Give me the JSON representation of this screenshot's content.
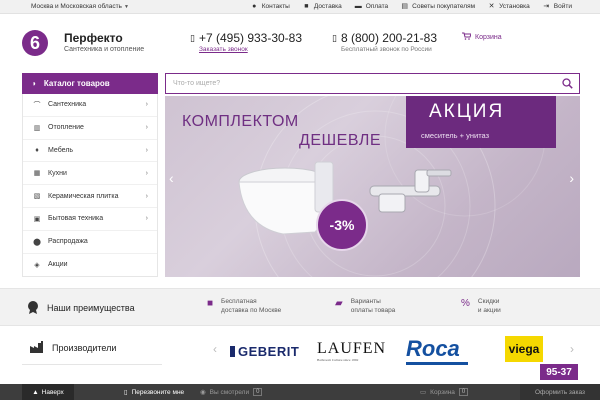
{
  "topbar": {
    "region": "Москва и Московская область",
    "links": [
      {
        "label": "Контакты",
        "icon": "location-pin-icon"
      },
      {
        "label": "Доставка",
        "icon": "truck-icon"
      },
      {
        "label": "Оплата",
        "icon": "chat-icon"
      },
      {
        "label": "Советы покупателям",
        "icon": "book-icon"
      },
      {
        "label": "Установка",
        "icon": "tools-icon"
      },
      {
        "label": "Войти",
        "icon": "login-icon"
      }
    ]
  },
  "header": {
    "logo_char": "6",
    "brand": "Перфекто",
    "tagline": "Сантехника и отопление",
    "phone1": "+7 (495) 933-30-83",
    "callback": "Заказать звонок",
    "phone2": "8 (800) 200-21-83",
    "free_call": "Бесплатный звонок по России",
    "cart": "Корзина"
  },
  "catalog": {
    "title": "Каталог товаров",
    "items": [
      {
        "label": "Сантехника",
        "icon": "faucet-icon",
        "has_sub": true
      },
      {
        "label": "Отопление",
        "icon": "radiator-icon",
        "has_sub": true
      },
      {
        "label": "Мебель",
        "icon": "lamp-icon",
        "has_sub": true
      },
      {
        "label": "Кухни",
        "icon": "kitchen-icon",
        "has_sub": true
      },
      {
        "label": "Керамическая плитка",
        "icon": "tile-icon",
        "has_sub": true
      },
      {
        "label": "Бытовая техника",
        "icon": "washer-icon",
        "has_sub": true
      },
      {
        "label": "Распродажа",
        "icon": "sale-icon",
        "has_sub": false
      },
      {
        "label": "Акции",
        "icon": "tag-icon",
        "has_sub": false
      }
    ]
  },
  "search": {
    "placeholder": "Что-то ищете?"
  },
  "banner": {
    "line1": "КОМПЛЕКТОМ",
    "line2": "ДЕШЕВЛЕ",
    "promo_title": "АКЦИЯ",
    "promo_sub": "смеситель + унитаз",
    "discount": "-3%"
  },
  "advantages": {
    "title": "Наши преимущества",
    "items": [
      {
        "line1": "Бесплатная",
        "line2": "доставка по Москве",
        "icon": "truck-icon"
      },
      {
        "line1": "Варианты",
        "line2": "оплаты товара",
        "icon": "wallet-icon"
      },
      {
        "line1": "Скидки",
        "line2": "и акции",
        "icon": "percent-icon"
      }
    ]
  },
  "producers": {
    "title": "Производители",
    "brands": [
      "GEBERIT",
      "LAUFEN",
      "Roca",
      "viega"
    ],
    "laufen_sub": "Bathroom Culture since 1892",
    "viega_number": "95-37"
  },
  "bottombar": {
    "up": "Наверх",
    "callback": "Перезвоните мне",
    "viewed": "Вы смотрели",
    "viewed_count": "0",
    "cart": "Корзина",
    "cart_count": "0",
    "order": "Оформить заказ"
  },
  "colors": {
    "accent": "#7b2b8a"
  }
}
